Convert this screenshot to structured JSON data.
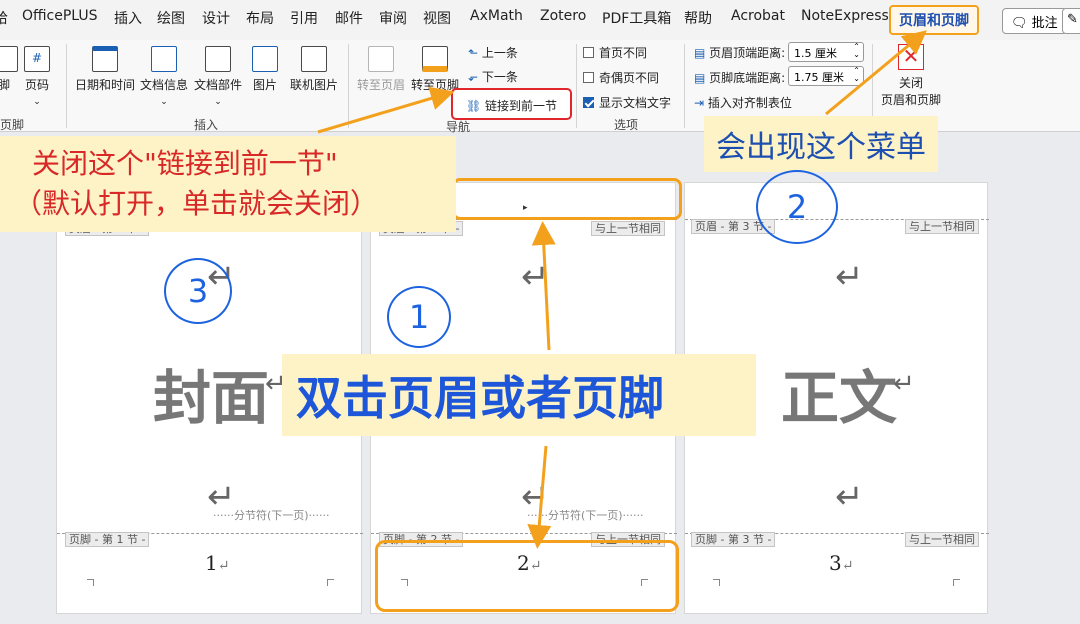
{
  "menu": {
    "tabs": [
      "哈",
      "OfficePLUS",
      "插入",
      "绘图",
      "设计",
      "布局",
      "引用",
      "邮件",
      "审阅",
      "视图",
      "AxMath",
      "Zotero",
      "PDF工具箱",
      "帮助",
      "Acrobat",
      "NoteExpress",
      "页眉和页脚"
    ],
    "comment_button": "批注",
    "edit_button": "✎"
  },
  "ribbon": {
    "header_footer_group": {
      "label": "页脚",
      "items": [
        "脚",
        "页码"
      ]
    },
    "insert_group": {
      "label": "插入",
      "items": [
        "日期和时间",
        "文档信息",
        "文档部件",
        "图片",
        "联机图片"
      ]
    },
    "nav_group": {
      "label": "导航",
      "goto_header": "转至页眉",
      "goto_footer": "转至页脚",
      "prev": "上一条",
      "next": "下一条",
      "link_prev": "链接到前一节"
    },
    "options_group": {
      "label": "选项",
      "first_page": "首页不同",
      "odd_even": "奇偶页不同",
      "show_text": "显示文档文字"
    },
    "position_group": {
      "header_top_label": "页眉顶端距离:",
      "header_top_value": "1.5 厘米",
      "footer_bottom_label": "页脚底端距离:",
      "footer_bottom_value": "1.75 厘米",
      "insert_align_tab": "插入对齐制表位"
    },
    "close_group": {
      "label_line1": "关闭",
      "label_line2": "页眉和页脚"
    }
  },
  "pages": [
    {
      "header_tag": "页眉 - 第 1 节 -",
      "footer_tag": "页脚 - 第 1 节 -",
      "footer_same": "",
      "header_same": "",
      "body_text": "封面",
      "break": "······分节符(下一页)······",
      "page_number": "1"
    },
    {
      "header_tag": "页眉 - 第 2 节 -",
      "footer_tag": "页脚 - 第 2 节 -",
      "footer_same": "与上一节相同",
      "header_same": "与上一节相同",
      "body_text": "",
      "break": "······分节符(下一页)······",
      "page_number": "2"
    },
    {
      "header_tag": "页眉 - 第 3 节 -",
      "footer_tag": "页脚 - 第 3 节 -",
      "footer_same": "与上一节相同",
      "header_same": "与上一节相同",
      "body_text": "正文",
      "break": "",
      "page_number": "3"
    }
  ],
  "annotations": {
    "close_link_line1": "关闭这个\"链接到前一节\"",
    "close_link_line2": "（默认打开，单击就会关闭）",
    "menu_appears": "会出现这个菜单",
    "double_click": "双击页眉或者页脚",
    "step1": "1",
    "step2": "2",
    "step3": "3"
  },
  "colors": {
    "highlight": "#f3a11d",
    "annotation_blue": "#1d63e0",
    "red_box": "#e0262b"
  }
}
